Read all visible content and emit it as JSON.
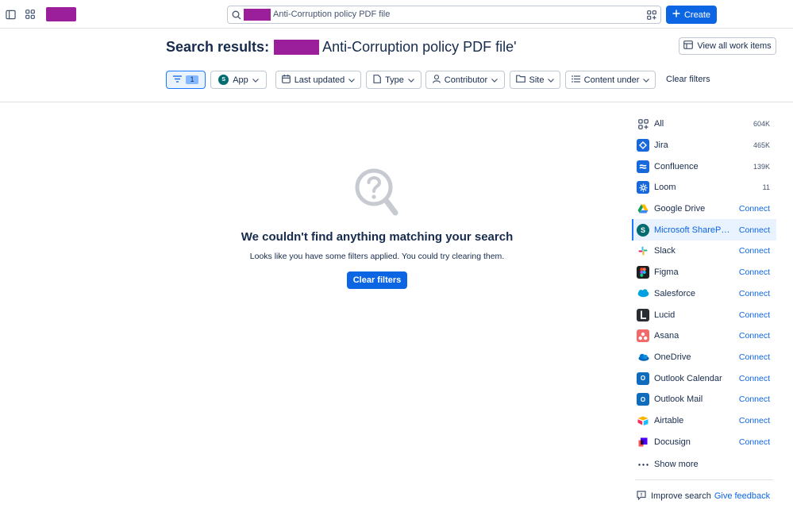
{
  "colors": {
    "brand_blue": "#0c66e4",
    "redaction": "#9b1f9b",
    "border": "#c1c7d0",
    "selected_bg": "#e9f2ff"
  },
  "topbar": {
    "sidebar_toggle_icon": "sidebar-toggle-icon",
    "app_switcher_icon": "app-switcher-icon",
    "search": {
      "value": "Anti-Corruption policy PDF file",
      "icon": "search-icon",
      "filter_icon": "filter-grid-icon"
    },
    "create_label": "Create"
  },
  "header": {
    "title_prefix": "Search results:",
    "title_query": "Anti-Corruption policy PDF file'",
    "view_all_label": "View all work items"
  },
  "filters": {
    "filter_count": "1",
    "app_label": "App",
    "last_updated_label": "Last updated",
    "type_label": "Type",
    "contributor_label": "Contributor",
    "site_label": "Site",
    "content_under_label": "Content under",
    "clear_label": "Clear filters"
  },
  "empty_state": {
    "title": "We couldn't find anything matching your search",
    "subtitle": "Looks like you have some filters applied. You could try clearing them.",
    "button_label": "Clear filters"
  },
  "sidebar": {
    "items": [
      {
        "label": "All",
        "right": "604K",
        "kind": "count",
        "icon": "all-apps-icon"
      },
      {
        "label": "Jira",
        "right": "465K",
        "kind": "count",
        "icon": "jira-icon"
      },
      {
        "label": "Confluence",
        "right": "139K",
        "kind": "count",
        "icon": "confluence-icon"
      },
      {
        "label": "Loom",
        "right": "11",
        "kind": "count",
        "icon": "loom-icon"
      },
      {
        "label": "Google Drive",
        "right": "Connect",
        "kind": "connect",
        "icon": "google-drive-icon"
      },
      {
        "label": "Microsoft SharePoint",
        "right": "Connect",
        "kind": "connect",
        "icon": "sharepoint-icon",
        "selected": true
      },
      {
        "label": "Slack",
        "right": "Connect",
        "kind": "connect",
        "icon": "slack-icon"
      },
      {
        "label": "Figma",
        "right": "Connect",
        "kind": "connect",
        "icon": "figma-icon"
      },
      {
        "label": "Salesforce",
        "right": "Connect",
        "kind": "connect",
        "icon": "salesforce-icon"
      },
      {
        "label": "Lucid",
        "right": "Connect",
        "kind": "connect",
        "icon": "lucid-icon"
      },
      {
        "label": "Asana",
        "right": "Connect",
        "kind": "connect",
        "icon": "asana-icon"
      },
      {
        "label": "OneDrive",
        "right": "Connect",
        "kind": "connect",
        "icon": "onedrive-icon"
      },
      {
        "label": "Outlook Calendar",
        "right": "Connect",
        "kind": "connect",
        "icon": "outlook-calendar-icon"
      },
      {
        "label": "Outlook Mail",
        "right": "Connect",
        "kind": "connect",
        "icon": "outlook-mail-icon"
      },
      {
        "label": "Airtable",
        "right": "Connect",
        "kind": "connect",
        "icon": "airtable-icon"
      },
      {
        "label": "Docusign",
        "right": "Connect",
        "kind": "connect",
        "icon": "docusign-icon"
      }
    ],
    "show_more_label": "Show more",
    "improve_label": "Improve search",
    "feedback_label": "Give feedback"
  }
}
